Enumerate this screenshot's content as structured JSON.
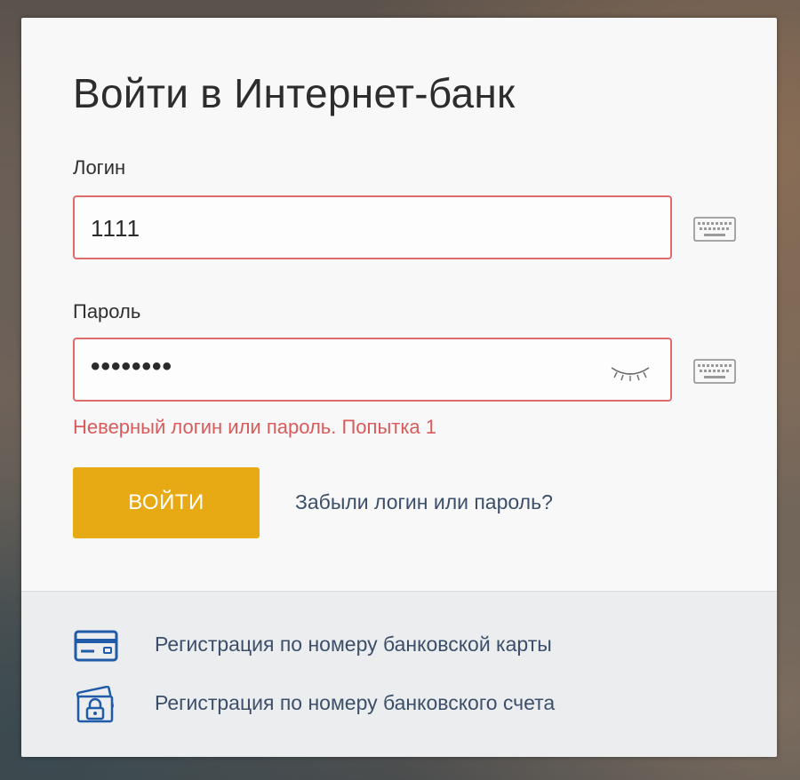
{
  "form": {
    "title": "Войти в Интернет-банк",
    "login_label": "Логин",
    "login_value": "1111",
    "password_label": "Пароль",
    "password_value": "••••••••",
    "error_message": "Неверный логин или пароль. Попытка 1",
    "submit_label": "ВОЙТИ",
    "forgot_link": "Забыли логин или пароль?"
  },
  "registration": {
    "by_card": "Регистрация по номеру банковской карты",
    "by_account": "Регистрация по номеру банковского счета"
  },
  "icons": {
    "virtual_keyboard": "keyboard-icon",
    "show_password": "eye-closed-icon",
    "card": "bank-card-icon",
    "account": "money-lock-icon"
  },
  "colors": {
    "error": "#d95b5b",
    "field_border_error": "#df6b6b",
    "submit_button": "#e8aa14",
    "link": "#3b4f6b",
    "icon_blue": "#1f5ba8"
  }
}
